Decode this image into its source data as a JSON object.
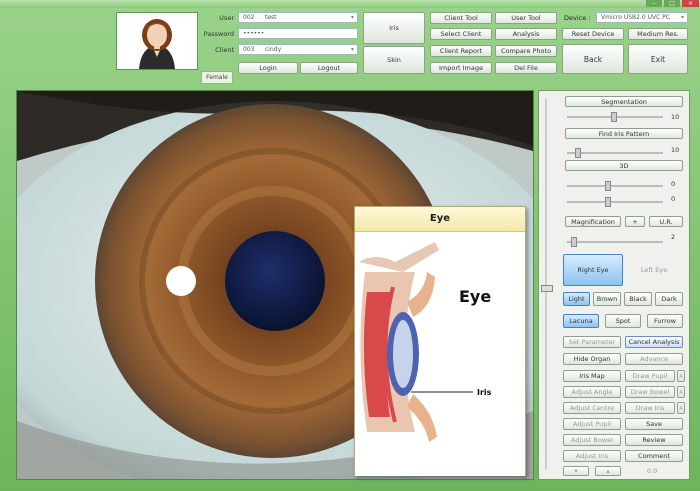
{
  "login": {
    "user_label": "User",
    "user_code": "002",
    "user_name": "test",
    "password_label": "Password",
    "password_value": "••••••",
    "client_label": "Client",
    "client_code": "003",
    "client_name": "cindy",
    "gender": "Female",
    "login_btn": "Login",
    "logout_btn": "Logout"
  },
  "modes": {
    "iris": "Iris",
    "skin": "Skin"
  },
  "toolbar": {
    "client_tool": "Client Tool",
    "user_tool": "User Tool",
    "select_client": "Select Client",
    "analysis": "Analysis",
    "client_report": "Client Report",
    "compare_photo": "Compare Photo",
    "import_image": "Import Image",
    "del_file": "Del File"
  },
  "device": {
    "label": "Device :",
    "value": "Vmicro USB2.0 UVC PC",
    "reset": "Reset Device",
    "resolution": "Medium Res.",
    "back": "Back",
    "exit": "Exit"
  },
  "popup": {
    "title": "Eye",
    "figure_title": "Eye",
    "figure_label": "Iris"
  },
  "panel": {
    "segmentation": "Segmentation",
    "seg_value": "10",
    "find_iris": "Find Iris Pattern",
    "find_value": "10",
    "three_d": "3D",
    "three_d_value_1": "0",
    "three_d_value_2": "0",
    "magnification": "Magnification",
    "plus": "+",
    "ur": "U.R.",
    "mag_value": "2",
    "right_eye": "Right Eye",
    "left_eye": "Left Eye",
    "light": "Light",
    "brown": "Brown",
    "black": "Black",
    "dark": "Dark",
    "lacuna": "Lacuna",
    "spot": "Spot",
    "furrow": "Furrow",
    "set_parameter": "Set Parameter",
    "cancel_analysis": "Cancel Analysis",
    "hide_organ": "Hide Organ",
    "advance": "Advance",
    "iris_map": "Iris Map",
    "draw_pupil": "Draw Pupil",
    "adjust_angle": "Adjust Angle",
    "draw_bowel": "Draw Bowel",
    "adjust_centre": "Adjust Centre",
    "draw_iris": "Draw Iris",
    "adjust_pupil": "Adjust Pupil",
    "save": "Save",
    "adjust_bowel": "Adjust Bowel",
    "review": "Review",
    "adjust_iris": "Adjust Iris",
    "comment": "Comment",
    "x_mark": "X",
    "bottom_value": "0.0"
  }
}
